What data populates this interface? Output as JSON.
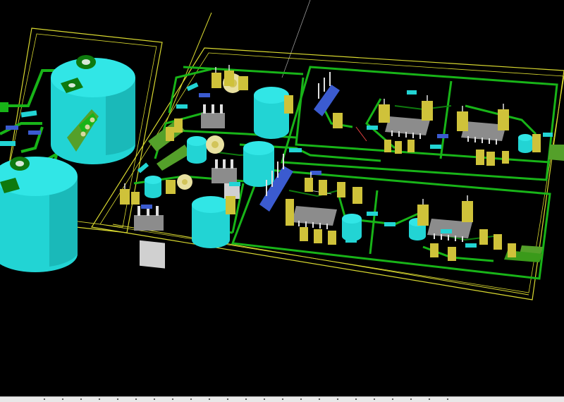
{
  "viewer": {
    "view_mode": "3d-pcb-view",
    "background": "#000000"
  },
  "colors": {
    "board_outline": "#d8d830",
    "copper_trace": "#18b418",
    "copper_dark": "#0e7a0e",
    "capacitor": "#22d4d4",
    "capacitor_shade": "#119a9a",
    "header_pin": "#3b5bd0",
    "trimmer_pot": "#d2c45a",
    "ic_body": "#8c8c8c",
    "pad": "#2aa02a"
  },
  "icons": [
    "electrolytic-capacitor-icon",
    "pin-header-icon",
    "ic-chip-icon",
    "voltage-regulator-icon",
    "trimmer-pot-icon"
  ]
}
